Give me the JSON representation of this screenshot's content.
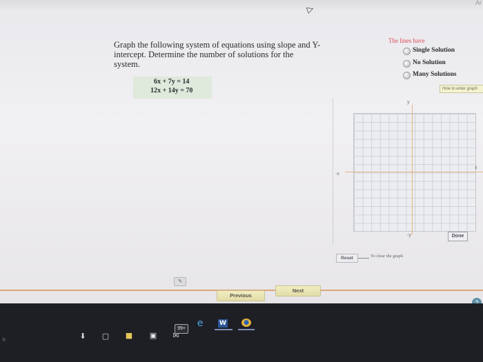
{
  "topbar": {
    "text": "Ar"
  },
  "question": {
    "text": "Graph the following system of equations using slope and Y-intercept. Determine the number of solutions for the system.",
    "equations": [
      "6x + 7y = 14",
      "12x + 14y = 70"
    ]
  },
  "options": {
    "heading": "The lines have",
    "choices": [
      "Single Solution",
      "No Solution",
      "Many Solutions"
    ]
  },
  "help_button": "How to enter graph",
  "graph": {
    "x_pos_label": "x",
    "x_neg_label": "-x",
    "y_pos_label": "y",
    "y_neg_label": "-y",
    "done_label": "Done",
    "reset_label": "Reset",
    "reset_note": "To clear the graph"
  },
  "nav": {
    "previous": "Previous",
    "next": "Next"
  },
  "taskbar": {
    "badge": "99+",
    "icons": [
      "microphone-icon",
      "task-view-icon",
      "file-explorer-icon",
      "store-icon",
      "mail-icon",
      "edge-icon",
      "word-icon",
      "chrome-icon"
    ]
  }
}
